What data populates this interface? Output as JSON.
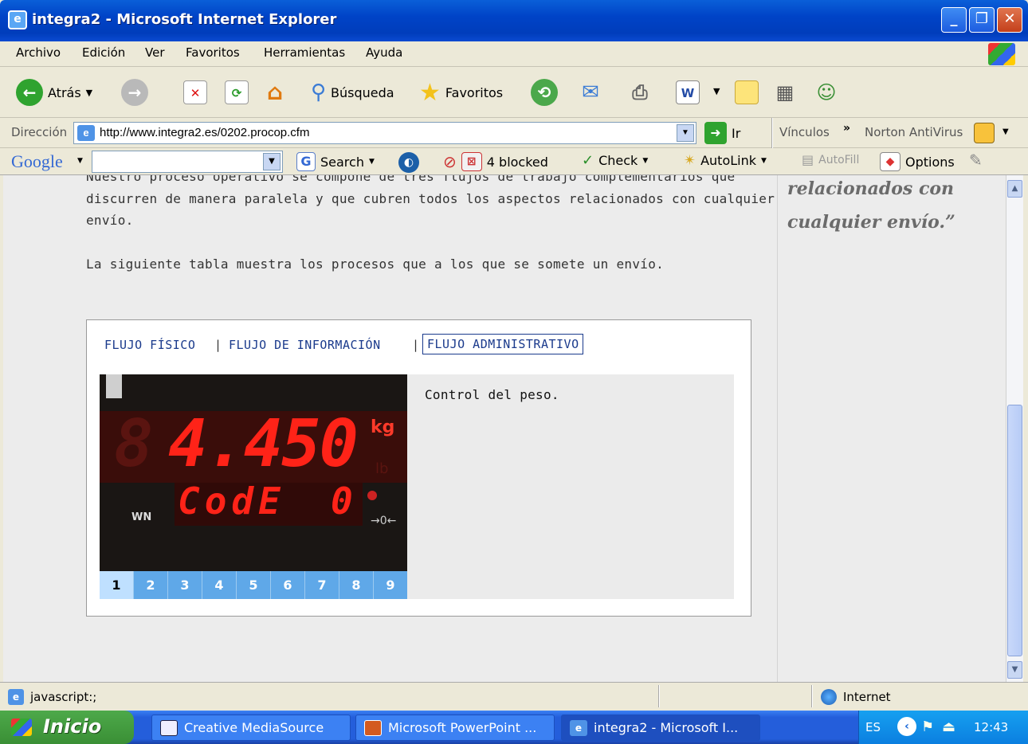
{
  "window": {
    "title": "integra2 - Microsoft Internet Explorer"
  },
  "menu": [
    "Archivo",
    "Edición",
    "Ver",
    "Favoritos",
    "Herramientas",
    "Ayuda"
  ],
  "toolbar": {
    "back_label": "Atrás",
    "search_label": "Búsqueda",
    "favorites_label": "Favoritos"
  },
  "address": {
    "label": "Dirección",
    "url": "http://www.integra2.es/0202.procop.cfm",
    "go_label": "Ir",
    "links_label": "Vínculos",
    "norton_label": "Norton AntiVirus"
  },
  "google": {
    "brand": "Google",
    "search_label": "Search",
    "blocked_label": "4 blocked",
    "check_label": "Check",
    "autolink_label": "AutoLink",
    "autofill_label": "AutoFill",
    "options_label": "Options"
  },
  "content": {
    "para1_top": "Nuestro proceso operativo se compone de tres flujos de trabajo complementarios que",
    "para1_line2": "discurren de manera paralela y que cubren todos los aspectos relacionados con cualquier",
    "para1_line3": "envío.",
    "para2": "La siguiente tabla muestra los procesos que a los que se somete un envío.",
    "tabs": [
      "FLUJO FÍSICO",
      "FLUJO DE INFORMACIÓN",
      "FLUJO ADMINISTRATIVO"
    ],
    "tab_sep": "|",
    "description": "Control del peso.",
    "scale": {
      "weight": "4.450",
      "unit": "kg",
      "unit2": "lb",
      "code_label": "CodE",
      "code_value": "0",
      "wn": "WN"
    },
    "pager": [
      "1",
      "2",
      "3",
      "4",
      "5",
      "6",
      "7",
      "8",
      "9"
    ],
    "active_page": "1"
  },
  "sidebar": {
    "quote_line1": "relacionados con",
    "quote_line2": "cualquier envío.”"
  },
  "status": {
    "text": "javascript:;",
    "zone": "Internet"
  },
  "taskbar": {
    "start": "Inicio",
    "tasks": [
      "Creative MediaSource",
      "Microsoft PowerPoint ...",
      "integra2 - Microsoft I..."
    ],
    "lang": "ES",
    "clock": "12:43"
  }
}
